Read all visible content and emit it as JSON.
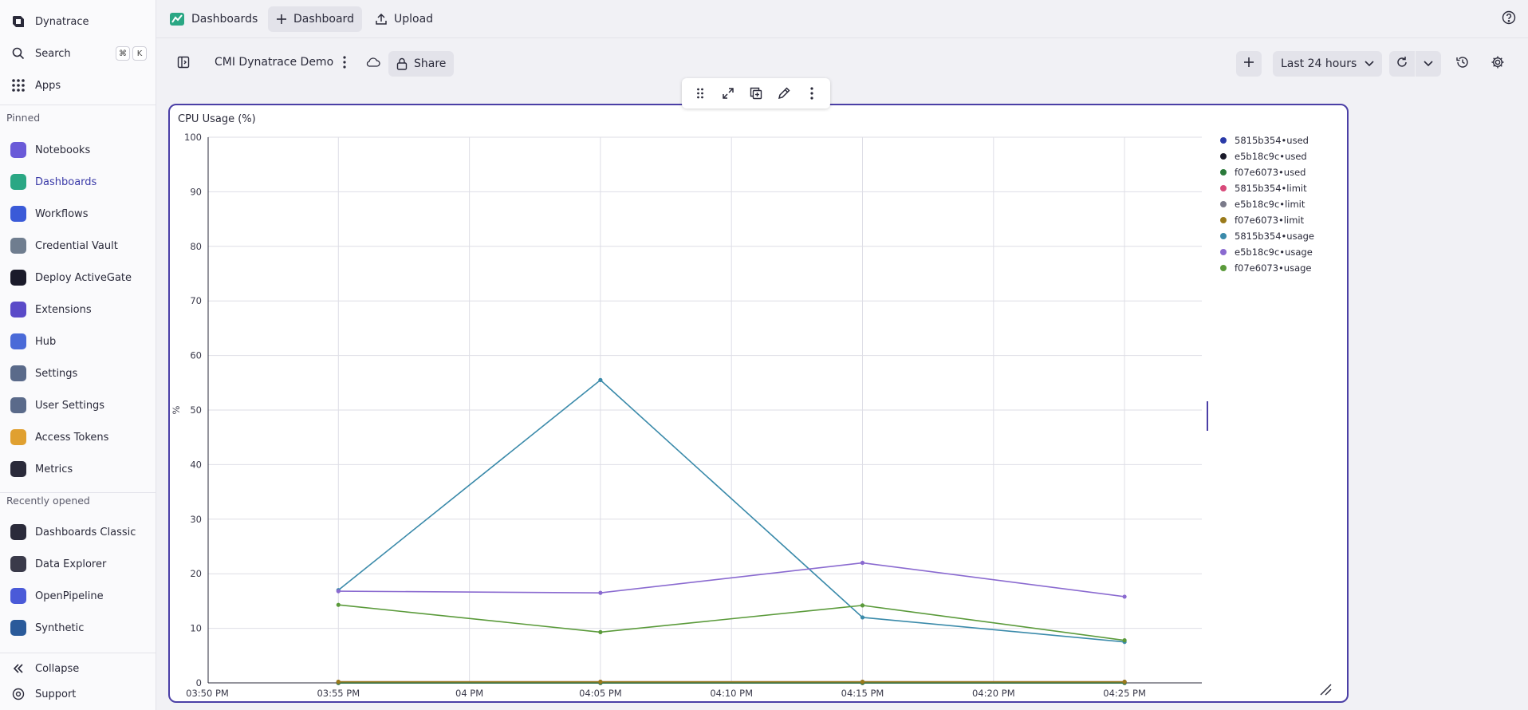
{
  "sidebar": {
    "brand": "Dynatrace",
    "search_label": "Search",
    "search_keys": [
      "⌘",
      "K"
    ],
    "apps_label": "Apps",
    "pinned_label": "Pinned",
    "pinned": [
      {
        "label": "Notebooks",
        "icon": "notebooks-icon",
        "color": "#6a5ad8"
      },
      {
        "label": "Dashboards",
        "icon": "dashboards-icon",
        "color": "#2aa784",
        "active": true
      },
      {
        "label": "Workflows",
        "icon": "workflows-icon",
        "color": "#3a5ad8"
      },
      {
        "label": "Credential Vault",
        "icon": "credential-vault-icon",
        "color": "#6f7d8f"
      },
      {
        "label": "Deploy ActiveGate",
        "icon": "activegate-icon",
        "color": "#1a1a2a"
      },
      {
        "label": "Extensions",
        "icon": "extensions-icon",
        "color": "#5a4ac8"
      },
      {
        "label": "Hub",
        "icon": "hub-icon",
        "color": "#4a6ad8"
      },
      {
        "label": "Settings",
        "icon": "settings-icon",
        "color": "#5a6a8a"
      },
      {
        "label": "User Settings",
        "icon": "user-settings-icon",
        "color": "#5a6a8a"
      },
      {
        "label": "Access Tokens",
        "icon": "access-tokens-icon",
        "color": "#e0a030"
      },
      {
        "label": "Metrics",
        "icon": "metrics-icon",
        "color": "#2a2a3a"
      }
    ],
    "recent_label": "Recently opened",
    "recent": [
      {
        "label": "Dashboards Classic",
        "icon": "dashboards-classic-icon",
        "color": "#2a2a3a"
      },
      {
        "label": "Data Explorer",
        "icon": "data-explorer-icon",
        "color": "#3a3a4a"
      },
      {
        "label": "OpenPipeline",
        "icon": "openpipeline-icon",
        "color": "#4a5ad8"
      },
      {
        "label": "Synthetic",
        "icon": "synthetic-icon",
        "color": "#2a5a9a"
      }
    ],
    "collapse_label": "Collapse",
    "support_label": "Support"
  },
  "topbar": {
    "dashboards_label": "Dashboards",
    "new_dashboard_label": "Dashboard",
    "upload_label": "Upload"
  },
  "dashboard": {
    "title": "CMI Dynatrace Demo",
    "share_label": "Share",
    "timeframe": "Last 24 hours"
  },
  "tile": {
    "title": "CPU Usage (%)"
  },
  "chart_data": {
    "type": "line",
    "title": "CPU Usage (%)",
    "ylabel": "%",
    "xlabel": "",
    "ylim": [
      0,
      100
    ],
    "y_ticks": [
      0,
      10,
      20,
      30,
      40,
      50,
      60,
      70,
      80,
      90,
      100
    ],
    "x_ticks": [
      "03:50 PM",
      "03:55 PM",
      "04 PM",
      "04:05 PM",
      "04:10 PM",
      "04:15 PM",
      "04:20 PM",
      "04:25 PM"
    ],
    "x": [
      "03:55 PM",
      "04:05 PM",
      "04:15 PM",
      "04:25 PM"
    ],
    "legend_position": "right",
    "series": [
      {
        "name": "5815b354•used",
        "color": "#2a3aa8",
        "values": [
          0,
          0,
          0,
          0
        ]
      },
      {
        "name": "e5b18c9c•used",
        "color": "#1a1a2a",
        "values": [
          0,
          0,
          0,
          0
        ]
      },
      {
        "name": "f07e6073•used",
        "color": "#2a7a3a",
        "values": [
          0,
          0,
          0,
          0
        ]
      },
      {
        "name": "5815b354•limit",
        "color": "#d84a7a",
        "values": [
          0.2,
          0.2,
          0.2,
          0.2
        ]
      },
      {
        "name": "e5b18c9c•limit",
        "color": "#7a7a8a",
        "values": [
          0.2,
          0.2,
          0.2,
          0.2
        ]
      },
      {
        "name": "f07e6073•limit",
        "color": "#9a7a1a",
        "values": [
          0.2,
          0.2,
          0.2,
          0.2
        ]
      },
      {
        "name": "5815b354•usage",
        "color": "#3a8aaa",
        "values": [
          17,
          55.5,
          12,
          7.5
        ]
      },
      {
        "name": "e5b18c9c•usage",
        "color": "#8a6ad0",
        "values": [
          16.8,
          16.5,
          22,
          15.8
        ]
      },
      {
        "name": "f07e6073•usage",
        "color": "#5a9a3a",
        "values": [
          14.3,
          9.3,
          14.2,
          7.8
        ]
      }
    ]
  }
}
